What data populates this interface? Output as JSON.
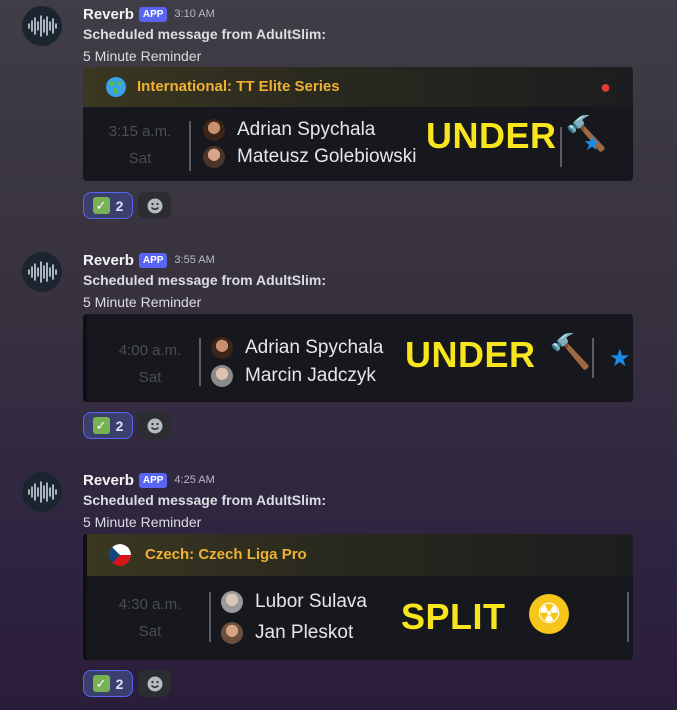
{
  "colors": {
    "accent": "#5865f2",
    "league": "#f0b132",
    "verdict": "#f9e51d"
  },
  "messages": [
    {
      "username": "Reverb",
      "badge": "APP",
      "time": "3:10 AM",
      "scheduled_label": "Scheduled message from AdultSlim:",
      "reminder": "5 Minute Reminder",
      "league": "International: TT Elite Series",
      "league_icon": "globe-icon",
      "match_time": "3:15 a.m.",
      "match_day": "Sat",
      "players": [
        "Adrian Spychala",
        "Mateusz Golebiowski"
      ],
      "verdict": "UNDER",
      "verdict_icons": [
        "hammer-icon",
        "star-icon"
      ],
      "reaction_count": "2"
    },
    {
      "username": "Reverb",
      "badge": "APP",
      "time": "3:55 AM",
      "scheduled_label": "Scheduled message from AdultSlim:",
      "reminder": "5 Minute Reminder",
      "match_time": "4:00 a.m.",
      "match_day": "Sat",
      "players": [
        "Adrian Spychala",
        "Marcin Jadczyk"
      ],
      "verdict": "UNDER",
      "verdict_icons": [
        "hammer-icon",
        "star-icon"
      ],
      "reaction_count": "2"
    },
    {
      "username": "Reverb",
      "badge": "APP",
      "time": "4:25 AM",
      "scheduled_label": "Scheduled message from AdultSlim:",
      "reminder": "5 Minute Reminder",
      "league": "Czech: Czech Liga Pro",
      "league_icon": "czech-flag-icon",
      "match_time": "4:30 a.m.",
      "match_day": "Sat",
      "players": [
        "Lubor Sulava",
        "Jan Pleskot"
      ],
      "verdict": "SPLIT",
      "verdict_icons": [
        "radioactive-icon"
      ],
      "reaction_count": "2"
    }
  ]
}
